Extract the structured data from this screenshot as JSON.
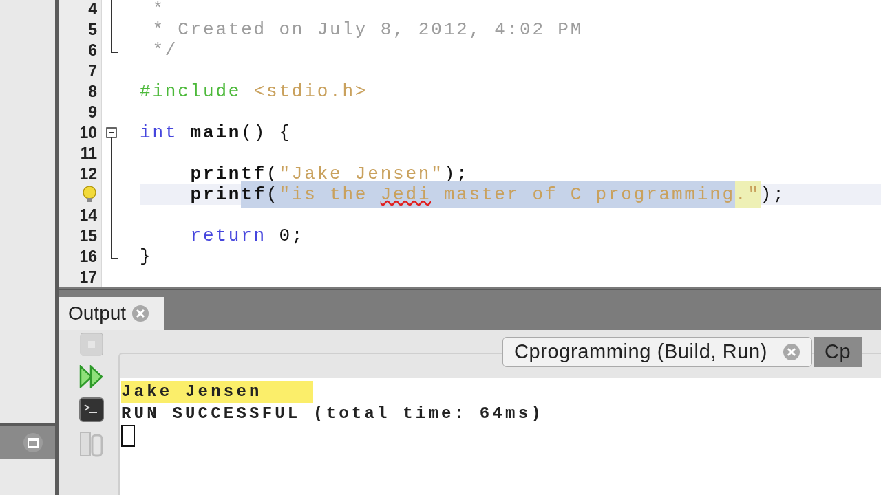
{
  "editor": {
    "lines": [
      {
        "number": "4",
        "kind": "fold_line",
        "current": false,
        "tokens": [
          {
            "text": " *",
            "kind": "comment",
            "selected": false
          }
        ]
      },
      {
        "number": "5",
        "kind": "fold_line",
        "current": false,
        "tokens": [
          {
            "text": " * Created on July 8, 2012, 4:02 PM",
            "kind": "comment",
            "selected": false
          }
        ]
      },
      {
        "number": "6",
        "kind": "fold_end",
        "current": false,
        "tokens": [
          {
            "text": " */",
            "kind": "comment",
            "selected": false
          }
        ]
      },
      {
        "number": "7",
        "kind": "plain",
        "current": false
      },
      {
        "number": "8",
        "kind": "plain",
        "current": false,
        "tokens": [
          {
            "text": "#include",
            "kind": "directive",
            "selected": false
          },
          {
            "text": " <stdio.h>",
            "kind": "string",
            "selected": false
          }
        ]
      },
      {
        "number": "9",
        "kind": "plain",
        "current": false
      },
      {
        "number": "10",
        "kind": "fold_start",
        "current": false,
        "tokens": [
          {
            "text": "int",
            "kind": "keyword",
            "selected": false
          },
          {
            "text": " main",
            "kind": "function",
            "selected": false
          },
          {
            "text": "() {",
            "kind": "plain",
            "selected": false
          }
        ]
      },
      {
        "number": "11",
        "kind": "fold_line",
        "current": false
      },
      {
        "number": "12",
        "kind": "fold_line",
        "current": false,
        "tokens": [
          {
            "text": "    printf",
            "kind": "function",
            "selected": false
          },
          {
            "text": "(",
            "kind": "plain",
            "selected": false
          },
          {
            "text": "\"Jake Jensen\"",
            "kind": "string",
            "selected": false
          },
          {
            "text": ");",
            "kind": "plain",
            "selected": false
          }
        ]
      },
      {
        "hint": true,
        "kind": "fold_line",
        "current": true,
        "tokens": [
          {
            "text": "    prin",
            "kind": "function",
            "selected": false
          },
          {
            "text": "tf",
            "kind": "function",
            "selected": true
          },
          {
            "text": "(",
            "kind": "plain",
            "selected": true
          },
          {
            "text": "\"is the ",
            "kind": "string",
            "selected": true
          },
          {
            "text": "Jedi",
            "kind": "string_misspelled",
            "selected": true
          },
          {
            "text": " master of C programming",
            "kind": "string",
            "selected": true
          },
          {
            "text": ".\"",
            "kind": "string_match",
            "selected": false
          },
          {
            "text": ");",
            "kind": "plain",
            "selected": false
          }
        ]
      },
      {
        "number": "14",
        "kind": "fold_line",
        "current": false
      },
      {
        "number": "15",
        "kind": "fold_line",
        "current": false,
        "tokens": [
          {
            "text": "    return",
            "kind": "keyword",
            "selected": false
          },
          {
            "text": " 0;",
            "kind": "plain",
            "selected": false
          }
        ]
      },
      {
        "number": "16",
        "kind": "fold_end",
        "current": false,
        "tokens": [
          {
            "text": "}",
            "kind": "plain",
            "selected": false
          }
        ]
      },
      {
        "number": "17",
        "kind": "plain",
        "current": false
      }
    ]
  },
  "output": {
    "title": "Output",
    "tabs": [
      {
        "label": "Cprogramming (Build, Run)",
        "selected": true,
        "closable": true
      },
      {
        "label": "Cp",
        "selected": false,
        "closable": false
      }
    ],
    "lines": [
      {
        "text": "Jake Jensen",
        "highlighted": true
      },
      {
        "text": "RUN SUCCESSFUL (total time: 64ms)",
        "highlighted": false
      }
    ]
  }
}
